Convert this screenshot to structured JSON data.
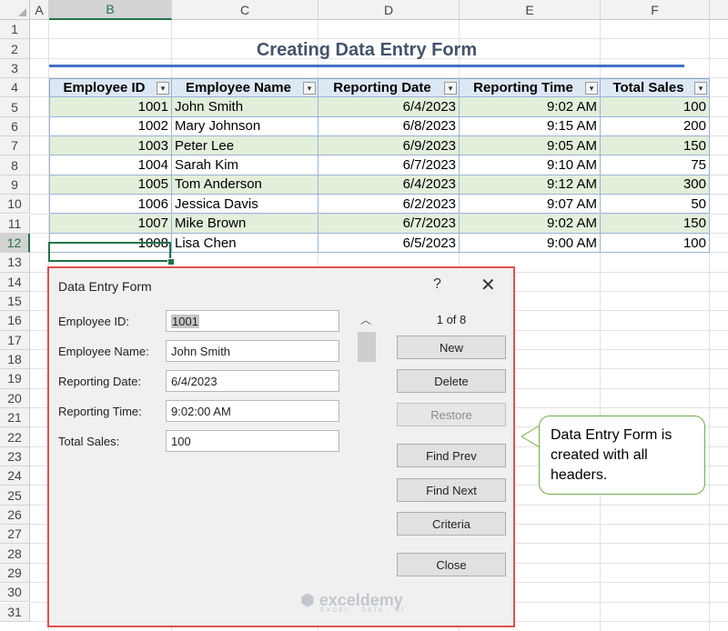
{
  "sheet": {
    "columns": [
      "A",
      "B",
      "C",
      "D",
      "E",
      "F"
    ],
    "selected_column": "B",
    "rows": [
      "1",
      "2",
      "3",
      "4",
      "5",
      "6",
      "7",
      "8",
      "9",
      "10",
      "11",
      "12",
      "13",
      "14",
      "15",
      "16",
      "17",
      "18",
      "19",
      "20",
      "21",
      "22",
      "23",
      "24",
      "25",
      "26",
      "27",
      "28",
      "29",
      "30",
      "31"
    ],
    "selected_row": "12",
    "title": "Creating Data Entry Form",
    "headers": [
      "Employee ID",
      "Employee Name",
      "Reporting Date",
      "Reporting Time",
      "Total Sales"
    ],
    "data": [
      [
        "1001",
        "John Smith",
        "6/4/2023",
        "9:02 AM",
        "100"
      ],
      [
        "1002",
        "Mary Johnson",
        "6/8/2023",
        "9:15 AM",
        "200"
      ],
      [
        "1003",
        "Peter Lee",
        "6/9/2023",
        "9:05 AM",
        "150"
      ],
      [
        "1004",
        "Sarah Kim",
        "6/7/2023",
        "9:10 AM",
        "75"
      ],
      [
        "1005",
        "Tom Anderson",
        "6/4/2023",
        "9:12 AM",
        "300"
      ],
      [
        "1006",
        "Jessica Davis",
        "6/2/2023",
        "9:07 AM",
        "50"
      ],
      [
        "1007",
        "Mike Brown",
        "6/7/2023",
        "9:02 AM",
        "150"
      ],
      [
        "1008",
        "Lisa Chen",
        "6/5/2023",
        "9:00 AM",
        "100"
      ]
    ],
    "filter_glyph": "▾"
  },
  "dialog": {
    "title": "Data Entry Form",
    "help": "?",
    "close_glyph": "✕",
    "counter": "1 of 8",
    "fields": [
      {
        "label": "Employee ID:",
        "value": "1001"
      },
      {
        "label": "Employee Name:",
        "value": "John Smith"
      },
      {
        "label": "Reporting Date:",
        "value": "6/4/2023"
      },
      {
        "label": "Reporting Time:",
        "value": "9:02:00 AM"
      },
      {
        "label": "Total Sales:",
        "value": "100"
      }
    ],
    "buttons": [
      {
        "label": "New",
        "enabled": true
      },
      {
        "label": "Delete",
        "enabled": true
      },
      {
        "label": "Restore",
        "enabled": false
      },
      {
        "label": "Find Prev",
        "enabled": true
      },
      {
        "label": "Find Next",
        "enabled": true
      },
      {
        "label": "Criteria",
        "enabled": true
      },
      {
        "label": "Close",
        "enabled": true
      }
    ],
    "scroll_up_glyph": "︿"
  },
  "callout": {
    "text": "Data Entry Form is created with all headers."
  },
  "watermark": {
    "brand": "exceldemy",
    "tagline": "EXCEL · DATA · BI"
  },
  "colors": {
    "accent_green": "#217346",
    "table_header": "#dde8f5",
    "band_green": "#e2efda",
    "dialog_border": "#e0504f",
    "title_color": "#44546a",
    "title_underline": "#4472c4"
  }
}
